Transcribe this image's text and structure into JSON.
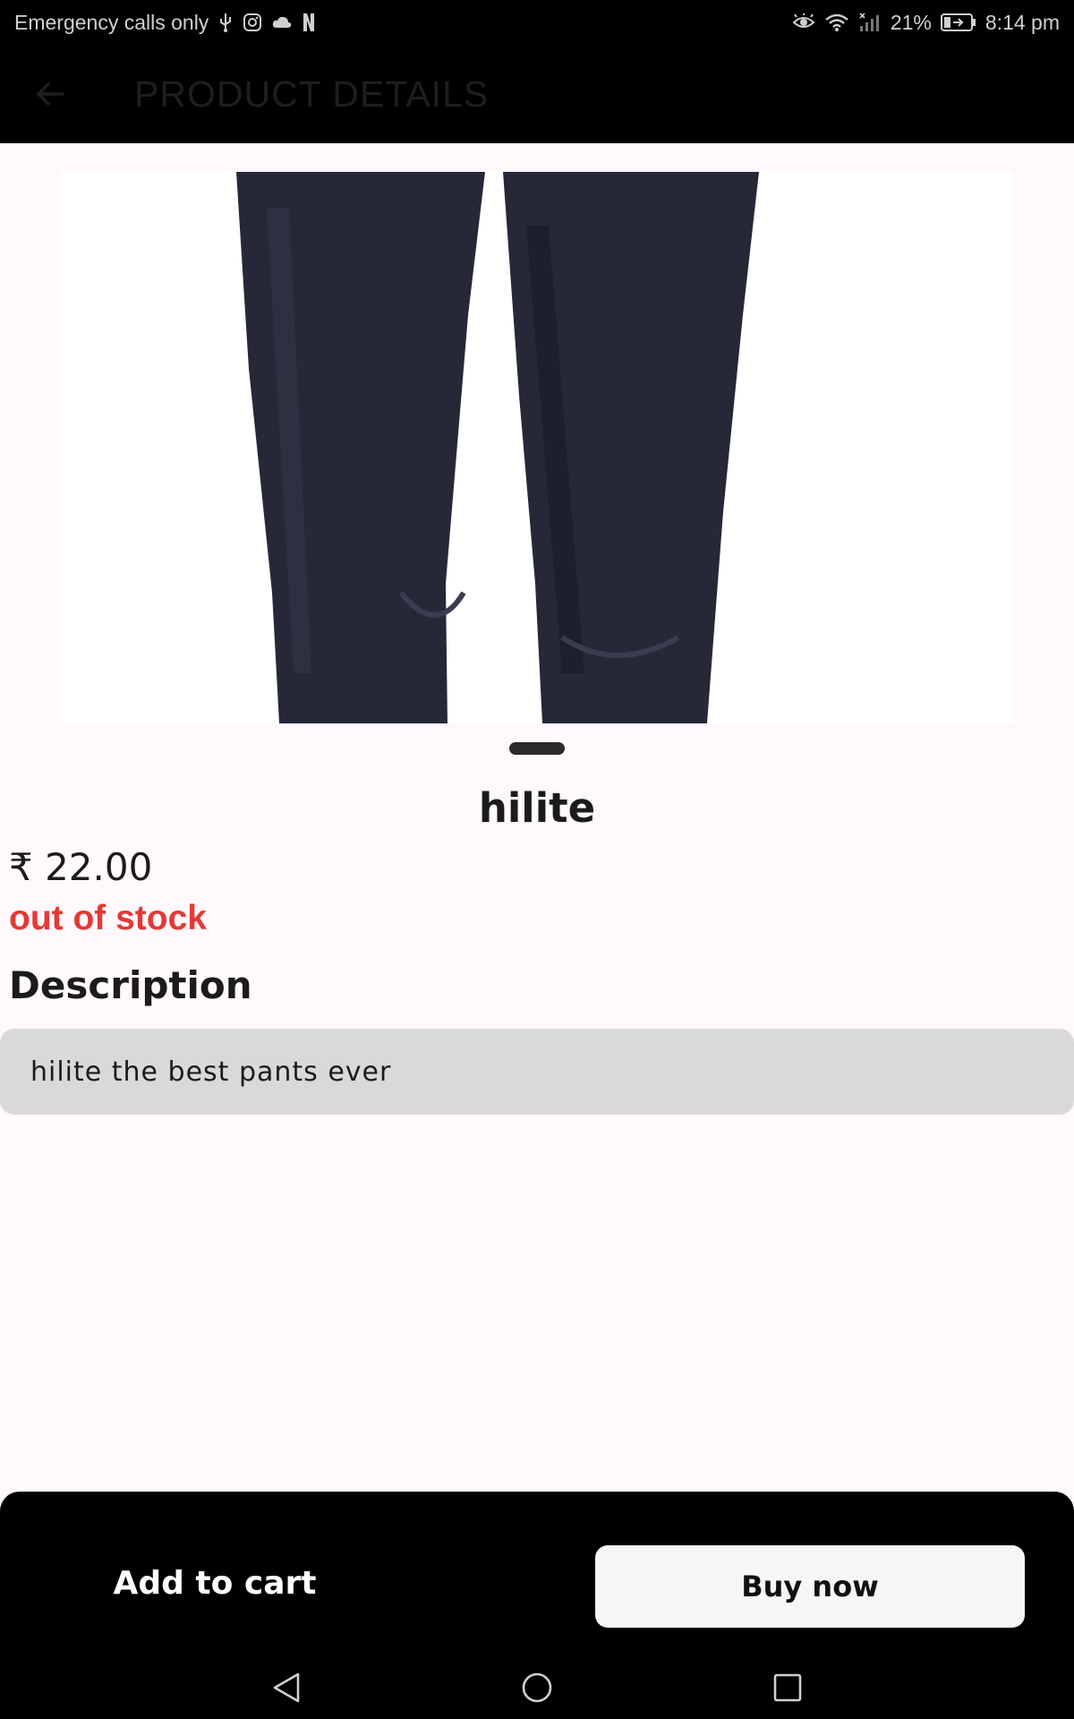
{
  "status_bar": {
    "carrier_text": "Emergency calls only",
    "battery_percent": "21%",
    "time": "8:14 pm",
    "icons": [
      "usb-icon",
      "instagram-icon",
      "cloud-icon",
      "netflix-icon",
      "eye-icon",
      "wifi-icon",
      "signal-icon",
      "battery-icon"
    ]
  },
  "app_bar": {
    "title": "PRODUCT DETAILS",
    "back_icon": "arrow-left-icon"
  },
  "product": {
    "image_subject": "navy trousers",
    "name": "hilite",
    "price": "₹ 22.00",
    "stock_status": "out of stock",
    "stock_color": "#e53935"
  },
  "description": {
    "heading": "Description",
    "text": "hilite the best pants ever"
  },
  "actions": {
    "add_to_cart": "Add to cart",
    "buy_now": "Buy now"
  },
  "nav_bar": {
    "icons": [
      "back-triangle-icon",
      "home-circle-icon",
      "recents-square-icon"
    ]
  }
}
